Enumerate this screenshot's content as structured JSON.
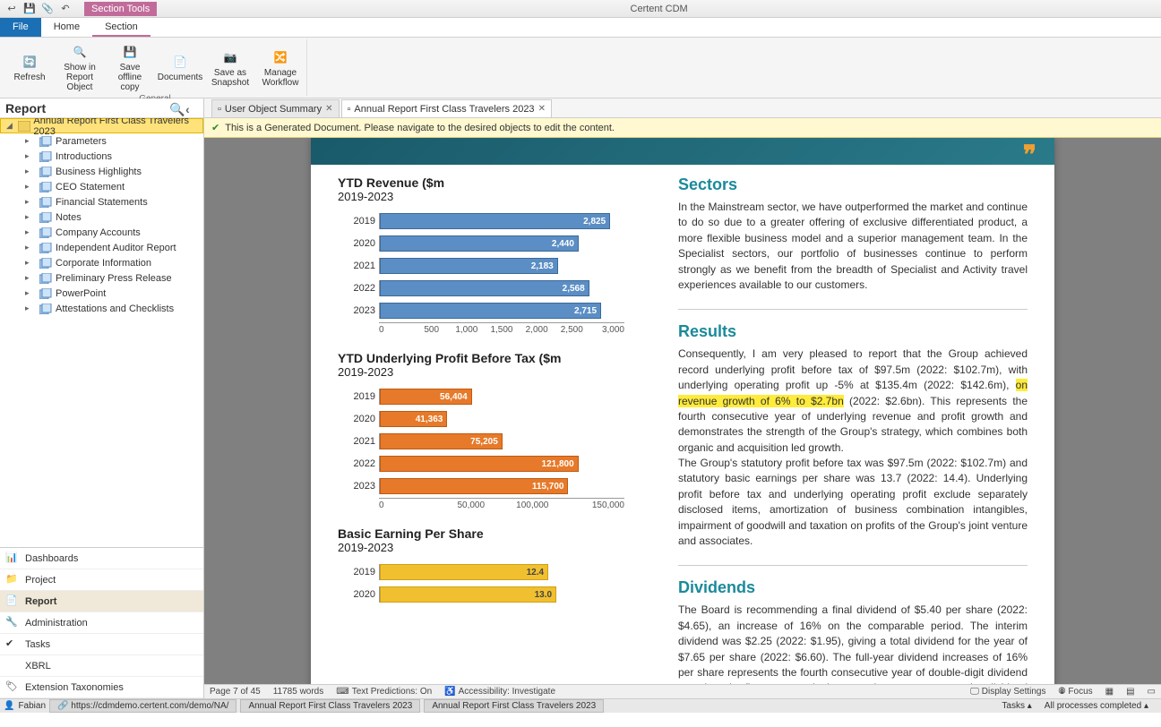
{
  "app": {
    "title": "Certent CDM"
  },
  "section_tools_label": "Section Tools",
  "qat": [
    "back",
    "save",
    "attach",
    "undo"
  ],
  "ribbon_tabs": {
    "file": "File",
    "home": "Home",
    "section": "Section"
  },
  "ribbon": {
    "group_name": "General",
    "buttons": [
      {
        "id": "refresh",
        "label": "Refresh"
      },
      {
        "id": "showin",
        "label": "Show in\nReport Object"
      },
      {
        "id": "saveoffline",
        "label": "Save offline\ncopy"
      },
      {
        "id": "documents",
        "label": "Documents"
      },
      {
        "id": "savesnap",
        "label": "Save as\nSnapshot"
      },
      {
        "id": "workflow",
        "label": "Manage\nWorkflow"
      }
    ]
  },
  "left": {
    "title": "Report",
    "root": "Annual Report First Class Travelers 2023",
    "children": [
      "Parameters",
      "Introductions",
      "Business Highlights",
      "CEO Statement",
      "Financial Statements",
      "Notes",
      "Company Accounts",
      "Independent Auditor Report",
      "Corporate Information",
      "Preliminary Press Release",
      "PowerPoint",
      "Attestations and Checklists"
    ],
    "nav": [
      "Dashboards",
      "Project",
      "Report",
      "Administration",
      "Tasks",
      "XBRL",
      "Extension Taxonomies"
    ],
    "nav_active": 2
  },
  "tabs": [
    {
      "label": "User Object Summary",
      "active": false
    },
    {
      "label": "Annual Report First Class Travelers 2023",
      "active": true
    }
  ],
  "infobar": "This is a Generated Document. Please navigate to the desired objects to edit the content.",
  "doc": {
    "sectors": {
      "title": "Sectors",
      "body": "In the Mainstream sector, we have outperformed the market and continue to do so due to a greater offering of exclusive differentiated product, a more flexible business model and a superior management team. In the Specialist sectors, our portfolio of businesses continue to perform strongly as we benefit from the breadth of Specialist and Activity travel experiences available to our customers."
    },
    "results": {
      "title": "Results",
      "body_pre": "Consequently, I am very pleased to report that the Group achieved record underlying profit before tax of $97.5m (2022: $102.7m), with underlying operating profit up -5% at $135.4m (2022: $142.6m), ",
      "body_hl": "on revenue growth of 6% to $2.7bn",
      "body_post": " (2022: $2.6bn). This represents the fourth consecutive year of underlying revenue and profit growth and demonstrates the strength of the Group's strategy, which combines both organic and acquisition led growth.\nThe Group's statutory profit before tax was $97.5m (2022: $102.7m) and statutory basic earnings per share was 13.7 (2022: 14.4). Underlying profit before tax and underlying operating profit exclude separately disclosed items, amortization of business combination intangibles, impairment of goodwill and taxation on profits of the Group's joint venture and associates."
    },
    "dividends": {
      "title": "Dividends",
      "body": "The Board is recommending a final dividend of $5.40 per share (2022: $4.65), an increase of 16% on the comparable period. The interim dividend was $2.25 (2022: $1.95), giving a total dividend for the year of $7.65 per share (2022: $6.60). The full-year dividend increases of 16% per share represents the fourth consecutive year of double-digit dividend growth and reflects our continuing commitment to a progressive dividend policy and our confidence in the future."
    }
  },
  "chart_data": [
    {
      "id": "revenue",
      "type": "bar",
      "orientation": "horizontal",
      "title": "YTD Revenue ($m",
      "subtitle": "2019-2023",
      "categories": [
        "2019",
        "2020",
        "2021",
        "2022",
        "2023"
      ],
      "values": [
        2825,
        2440,
        2183,
        2568,
        2715
      ],
      "xlim": [
        0,
        3000
      ],
      "xticks": [
        "0",
        "500",
        "1,000",
        "1,500",
        "2,000",
        "2,500",
        "3,000"
      ],
      "value_labels": [
        "2,825",
        "2,440",
        "2,183",
        "2,568",
        "2,715"
      ],
      "color": "blue"
    },
    {
      "id": "profit",
      "type": "bar",
      "orientation": "horizontal",
      "title": "YTD Underlying Profit Before Tax ($m",
      "subtitle": "2019-2023",
      "categories": [
        "2019",
        "2020",
        "2021",
        "2022",
        "2023"
      ],
      "values": [
        56404,
        41363,
        75205,
        121800,
        115700
      ],
      "xlim": [
        0,
        150000
      ],
      "xticks": [
        "0",
        "50,000",
        "100,000",
        "150,000"
      ],
      "value_labels": [
        "56,404",
        "41,363",
        "75,205",
        "121,800",
        "115,700"
      ],
      "color": "orange"
    },
    {
      "id": "eps",
      "type": "bar",
      "orientation": "horizontal",
      "title": "Basic Earning Per Share",
      "subtitle": "2019-2023",
      "categories": [
        "2019",
        "2020"
      ],
      "values": [
        12.4,
        13.0
      ],
      "xlim": [
        0,
        18
      ],
      "value_labels": [
        "12.4",
        "13.0"
      ],
      "color": "yellow"
    }
  ],
  "docstatus": {
    "page": "Page 7 of 45",
    "words": "11785 words",
    "predictions": "Text Predictions: On",
    "accessibility": "Accessibility: Investigate",
    "display": "Display Settings",
    "focus": "Focus"
  },
  "footer": {
    "user": "Fabian",
    "url": "https://cdmdemo.certent.com/demo/NA/",
    "crumb1": "Annual Report First Class Travelers 2023",
    "crumb2": "Annual Report First Class Travelers 2023",
    "tasks": "Tasks",
    "processes": "All processes completed"
  }
}
